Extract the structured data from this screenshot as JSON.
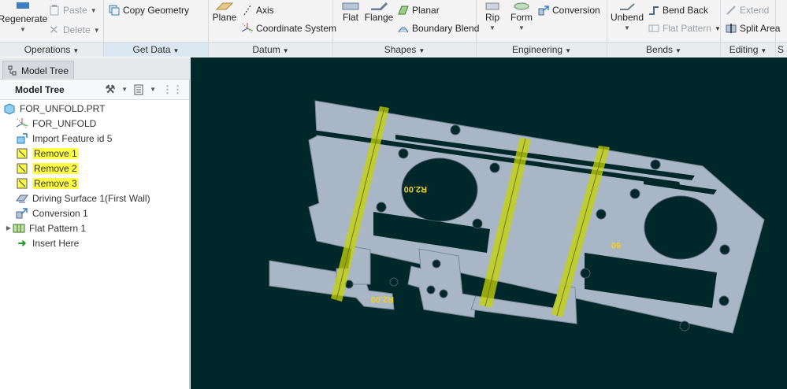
{
  "ribbon": {
    "operations": {
      "regenerate": "Regenerate",
      "paste": "Paste",
      "delete": "Delete",
      "label": "Operations"
    },
    "get_data": {
      "copy_geometry": "Copy Geometry",
      "label": "Get Data"
    },
    "datum": {
      "plane": "Plane",
      "axis": "Axis",
      "coordinate_system": "Coordinate System",
      "label": "Datum"
    },
    "shapes": {
      "flat": "Flat",
      "flange": "Flange",
      "planar": "Planar",
      "boundary_blend": "Boundary Blend",
      "label": "Shapes"
    },
    "engineering": {
      "rip": "Rip",
      "form": "Form",
      "conversion": "Conversion",
      "label": "Engineering"
    },
    "bends": {
      "unbend": "Unbend",
      "bend_back": "Bend Back",
      "flat_pattern": "Flat Pattern",
      "label": "Bends"
    },
    "editing": {
      "extend": "Extend",
      "split_area": "Split Area",
      "label": "Editing"
    },
    "overflow_label": "S"
  },
  "panel": {
    "tab_label": "Model Tree",
    "header_title": "Model Tree"
  },
  "tree": {
    "root": "FOR_UNFOLD.PRT",
    "items": [
      "FOR_UNFOLD",
      "Import Feature id 5",
      "Remove 1",
      "Remove 2",
      "Remove 3",
      "Driving Surface 1(First Wall)",
      "Conversion 1",
      "Flat Pattern 1",
      "Insert Here"
    ]
  },
  "viewport": {
    "annotations": [
      "R2.00",
      "R2.00",
      "60"
    ]
  },
  "colors": {
    "viewport_bg": "#00272a",
    "sheet_fill": "#a9b6c6",
    "highlight_yellow": "#ffff44",
    "bend_zone": "#c8d400"
  }
}
